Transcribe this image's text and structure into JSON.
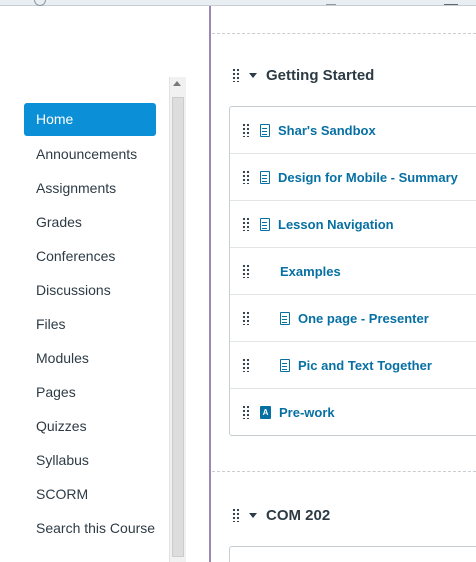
{
  "sidebar": {
    "items": [
      {
        "label": "Home",
        "active": true
      },
      {
        "label": "Announcements"
      },
      {
        "label": "Assignments"
      },
      {
        "label": "Grades"
      },
      {
        "label": "Conferences"
      },
      {
        "label": "Discussions"
      },
      {
        "label": "Files"
      },
      {
        "label": "Modules"
      },
      {
        "label": "Pages"
      },
      {
        "label": "Quizzes"
      },
      {
        "label": "Syllabus"
      },
      {
        "label": "SCORM"
      },
      {
        "label": "Search this Course"
      }
    ]
  },
  "modules": [
    {
      "title": "Getting Started",
      "items": [
        {
          "label": "Shar's Sandbox",
          "icon": "page-icon"
        },
        {
          "label": "Design for Mobile - Summary",
          "icon": "page-icon"
        },
        {
          "label": "Lesson Navigation",
          "icon": "page-icon"
        },
        {
          "label": "Examples",
          "icon": "none"
        },
        {
          "label": "One page - Presenter",
          "icon": "page-icon"
        },
        {
          "label": "Pic and Text Together",
          "icon": "page-icon"
        },
        {
          "label": "Pre-work",
          "icon": "quiz-icon"
        }
      ]
    },
    {
      "title": "COM 202",
      "items": []
    }
  ],
  "colors": {
    "accent": "#0b8fd6",
    "link": "#0770a3",
    "text": "#2d3b45",
    "divider": "#9b86b8"
  }
}
